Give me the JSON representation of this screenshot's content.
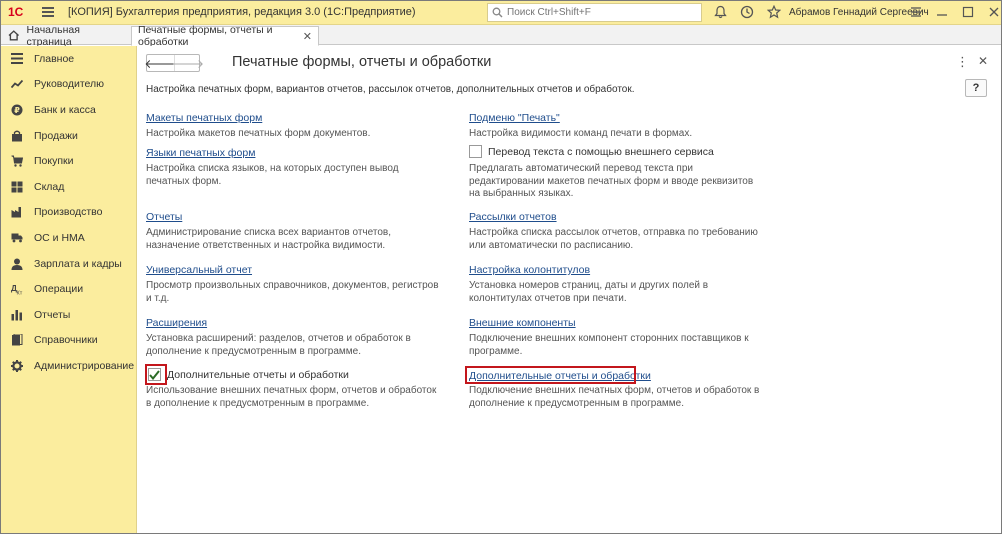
{
  "titlebar": {
    "logo": "1С",
    "app_title": "[КОПИЯ] Бухгалтерия предприятия, редакция 3.0  (1С:Предприятие)",
    "search_placeholder": "Поиск Ctrl+Shift+F",
    "username": "Абрамов Геннадий Сергеевич"
  },
  "tabs": {
    "home": "Начальная страница",
    "active": "Печатные формы, отчеты и обработки"
  },
  "sidebar": {
    "items": [
      {
        "label": "Главное",
        "icon": "menu-icon"
      },
      {
        "label": "Руководителю",
        "icon": "trend-icon"
      },
      {
        "label": "Банк и касса",
        "icon": "coin-icon"
      },
      {
        "label": "Продажи",
        "icon": "bag-icon"
      },
      {
        "label": "Покупки",
        "icon": "cart-icon"
      },
      {
        "label": "Склад",
        "icon": "grid-icon"
      },
      {
        "label": "Производство",
        "icon": "factory-icon"
      },
      {
        "label": "ОС и НМА",
        "icon": "truck-icon"
      },
      {
        "label": "Зарплата и кадры",
        "icon": "person-icon"
      },
      {
        "label": "Операции",
        "icon": "operations-icon"
      },
      {
        "label": "Отчеты",
        "icon": "bar-chart-icon"
      },
      {
        "label": "Справочники",
        "icon": "books-icon"
      },
      {
        "label": "Администрирование",
        "icon": "gear-icon"
      }
    ]
  },
  "main": {
    "title": "Печатные формы, отчеты и обработки",
    "description": "Настройка печатных форм, вариантов отчетов, рассылок отчетов, дополнительных отчетов и обработок.",
    "help_label": "?",
    "left": {
      "layouts_link": "Макеты печатных форм",
      "layouts_desc": "Настройка макетов печатных форм документов.",
      "languages_link": "Языки печатных форм",
      "languages_desc": "Настройка списка языков, на которых доступен вывод печатных форм.",
      "reports_link": "Отчеты",
      "reports_desc": "Администрирование списка всех вариантов отчетов, назначение ответственных и настройка видимости.",
      "universal_link": "Универсальный отчет",
      "universal_desc": "Просмотр произвольных справочников, документов, регистров и т.д.",
      "extensions_link": "Расширения",
      "extensions_desc": "Установка расширений: разделов, отчетов и обработок в дополнение к предусмотренным в программе.",
      "additional_checkbox": "Дополнительные отчеты и обработки",
      "additional_checked": true,
      "additional_desc": "Использование внешних печатных форм, отчетов и обработок в дополнение к предусмотренным в программе."
    },
    "right": {
      "submenu_link": "Подменю \"Печать\"",
      "submenu_desc": "Настройка видимости команд печати в формах.",
      "translate_checkbox": "Перевод текста с помощью внешнего сервиса",
      "translate_checked": false,
      "translate_desc": "Предлагать автоматический перевод текста при редактировании макетов печатных форм и вводе реквизитов на выбранных языках.",
      "mailings_link": "Рассылки отчетов",
      "mailings_desc": "Настройка списка рассылок отчетов, отправка по требованию или автоматически по расписанию.",
      "headers_link": "Настройка колонтитулов",
      "headers_desc": "Установка номеров страниц, даты и других полей в колонтитулах отчетов при печати.",
      "components_link": "Внешние компоненты",
      "components_desc": "Подключение внешних компонент сторонних поставщиков к программе.",
      "additional_link": "Дополнительные отчеты и обработки",
      "additional_desc": "Подключение внешних печатных форм, отчетов и обработок в дополнение к предусмотренным в программе."
    }
  },
  "colors": {
    "sidebar_bg": "#fbed9e",
    "link": "#1f4d8c",
    "highlight": "#c3161c"
  }
}
